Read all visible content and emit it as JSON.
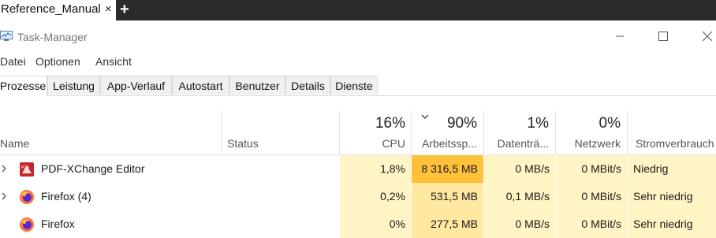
{
  "top_tab": {
    "title": "Reference_Manual",
    "close": "×",
    "new_tab": "+"
  },
  "window": {
    "title": "Task-Manager",
    "icon": "task-manager-icon"
  },
  "menu": [
    "Datei",
    "Optionen",
    "Ansicht"
  ],
  "tabs": [
    "Prozesse",
    "Leistung",
    "App-Verlauf",
    "Autostart",
    "Benutzer",
    "Details",
    "Dienste"
  ],
  "active_tab": "Prozesse",
  "columns": {
    "name": "Name",
    "status": "Status",
    "cpu": {
      "pct": "16%",
      "label": "CPU"
    },
    "memory": {
      "pct": "90%",
      "label": "Arbeitssp..."
    },
    "disk": {
      "pct": "1%",
      "label": "Datenträ..."
    },
    "network": {
      "pct": "0%",
      "label": "Netzwerk"
    },
    "power": {
      "label": "Stromverbrauch"
    }
  },
  "processes": [
    {
      "name": "PDF-XChange Editor",
      "icon": "pdf-xchange-icon",
      "cpu": "1,8%",
      "memory": "8 316,5 MB",
      "disk": "0 MB/s",
      "network": "0 MBit/s",
      "power": "Niedrig"
    },
    {
      "name": "Firefox (4)",
      "icon": "firefox-icon",
      "cpu": "0,2%",
      "memory": "531,5 MB",
      "disk": "0,1 MB/s",
      "network": "0 MBit/s",
      "power": "Sehr niedrig"
    },
    {
      "name": "Firefox",
      "icon": "firefox-icon",
      "cpu": "0%",
      "memory": "277,5 MB",
      "disk": "0 MB/s",
      "network": "0 MBit/s",
      "power": "Sehr niedrig"
    }
  ],
  "colors": {
    "heat_low": "#fff4c4",
    "heat_mid": "#ffe8a0",
    "heat_high": "#ffc03a",
    "topbar": "#2b2b2b"
  }
}
